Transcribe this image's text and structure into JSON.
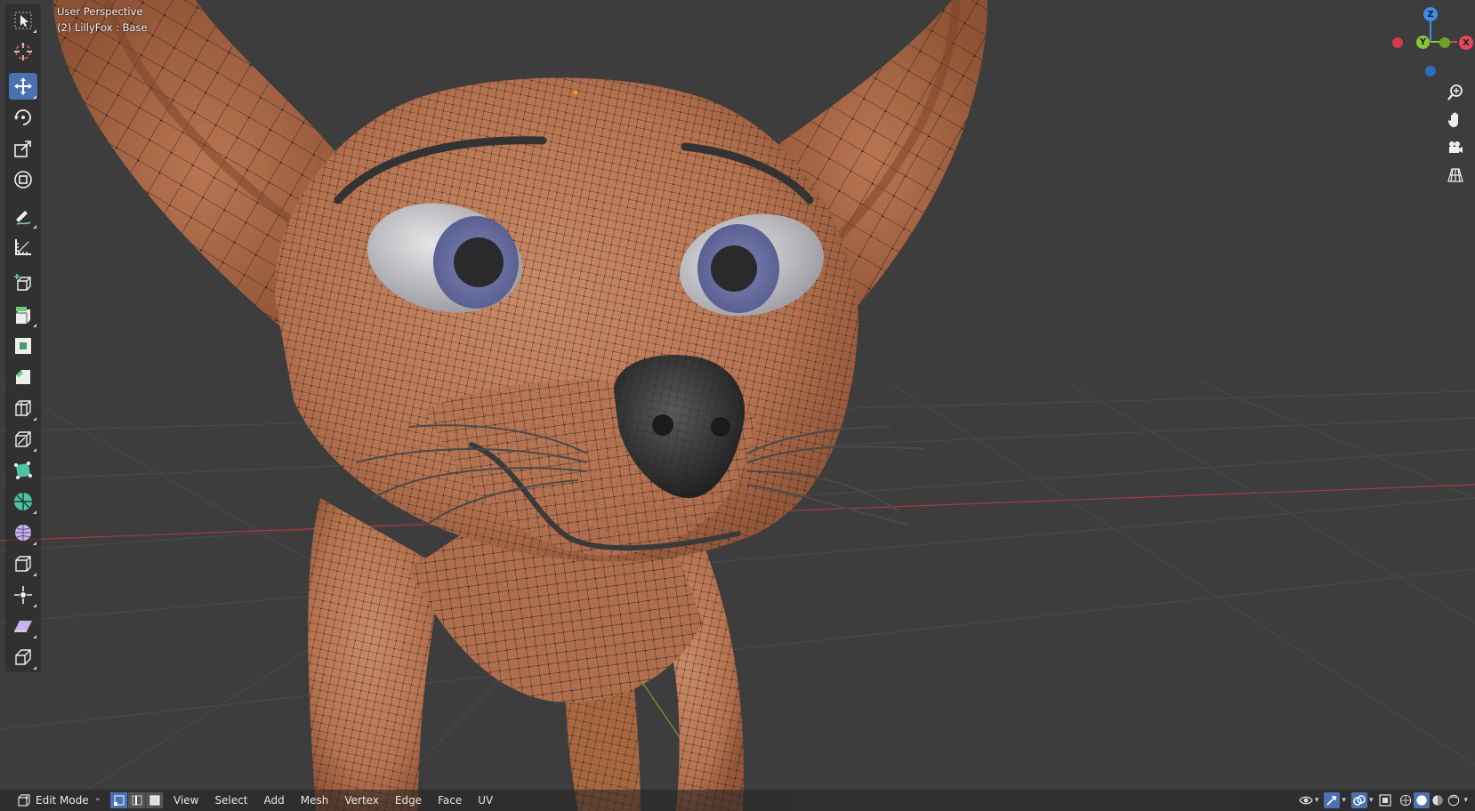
{
  "viewport": {
    "view_name": "User Perspective",
    "object_name": "(2) LillyFox : Base"
  },
  "toolbar": {
    "tools": [
      {
        "name": "select-box-tool",
        "icon": "cursor-select-icon",
        "active": false
      },
      {
        "name": "cursor-tool",
        "icon": "3d-cursor-icon",
        "active": false
      },
      {
        "name": "move-tool",
        "icon": "move-arrows-icon",
        "active": true
      },
      {
        "name": "rotate-tool",
        "icon": "rotate-icon",
        "active": false
      },
      {
        "name": "scale-tool",
        "icon": "scale-icon",
        "active": false
      },
      {
        "name": "transform-tool",
        "icon": "transform-icon",
        "active": false
      },
      {
        "name": "annotate-tool",
        "icon": "annotate-pencil-icon",
        "active": false
      },
      {
        "name": "measure-tool",
        "icon": "measure-ruler-icon",
        "active": false
      },
      {
        "name": "add-cube-tool",
        "icon": "add-cube-icon",
        "active": false
      },
      {
        "name": "extrude-tool",
        "icon": "extrude-region-icon",
        "active": false
      },
      {
        "name": "inset-faces-tool",
        "icon": "inset-faces-icon",
        "active": false
      },
      {
        "name": "bevel-tool",
        "icon": "bevel-icon",
        "active": false
      },
      {
        "name": "loop-cut-tool",
        "icon": "loop-cut-icon",
        "active": false
      },
      {
        "name": "knife-tool",
        "icon": "knife-icon",
        "active": false
      },
      {
        "name": "poly-build-tool",
        "icon": "poly-build-icon",
        "active": false
      },
      {
        "name": "spin-tool",
        "icon": "spin-icon",
        "active": false
      },
      {
        "name": "smooth-tool",
        "icon": "smooth-sphere-icon",
        "active": false
      },
      {
        "name": "edge-slide-tool",
        "icon": "edge-slide-icon",
        "active": false
      },
      {
        "name": "shrink-fatten-tool",
        "icon": "shrink-fatten-icon",
        "active": false
      },
      {
        "name": "shear-tool",
        "icon": "shear-icon",
        "active": false
      },
      {
        "name": "rip-region-tool",
        "icon": "rip-region-icon",
        "active": false
      }
    ]
  },
  "gizmo": {
    "axes": {
      "x": "X",
      "y": "Y",
      "z": "Z"
    },
    "colors": {
      "x": "#e8475a",
      "y": "#8bc639",
      "z": "#3c8ef0"
    }
  },
  "nav_controls": [
    "zoom-icon",
    "hand-pan-icon",
    "camera-icon",
    "perspective-grid-icon"
  ],
  "header": {
    "mode": "Edit Mode",
    "menus": [
      "View",
      "Select",
      "Add",
      "Mesh",
      "Vertex",
      "Edge",
      "Face",
      "UV"
    ],
    "select_modes": [
      "vertex-select-icon",
      "edge-select-icon",
      "face-select-icon"
    ]
  },
  "colors": {
    "background": "#3d3d3d",
    "skin": "#bd7b58",
    "wire": "#151515",
    "active_blue": "#4a72b2",
    "x_axis_line": "#a83a40",
    "y_axis_line": "#7e9a2e"
  }
}
